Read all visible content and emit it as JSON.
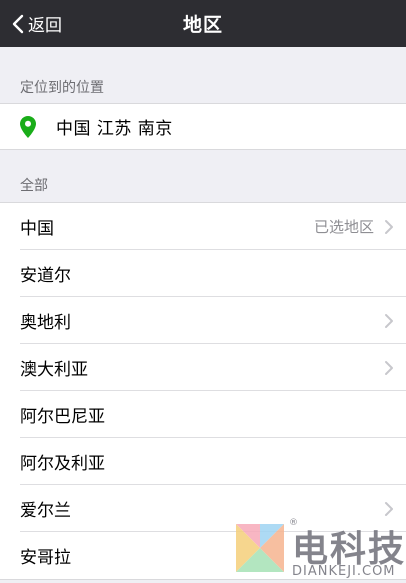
{
  "nav": {
    "back_label": "返回",
    "title": "地区"
  },
  "located_section": {
    "header": "定位到的位置",
    "location": "中国 江苏 南京"
  },
  "all_section": {
    "header": "全部",
    "rows": [
      {
        "name": "中国",
        "detail": "已选地区",
        "chevron": true
      },
      {
        "name": "安道尔",
        "detail": "",
        "chevron": false
      },
      {
        "name": "奥地利",
        "detail": "",
        "chevron": true
      },
      {
        "name": "澳大利亚",
        "detail": "",
        "chevron": true
      },
      {
        "name": "阿尔巴尼亚",
        "detail": "",
        "chevron": false
      },
      {
        "name": "阿尔及利亚",
        "detail": "",
        "chevron": false
      },
      {
        "name": "爱尔兰",
        "detail": "",
        "chevron": true
      },
      {
        "name": "安哥拉",
        "detail": "",
        "chevron": false
      }
    ]
  },
  "watermark": {
    "brand": "电科技",
    "sub": "DIANKEJI.COM",
    "reg": "®"
  },
  "colors": {
    "nav_bg": "#2d2d32",
    "pin": "#1aad19",
    "background": "#efeff4"
  }
}
